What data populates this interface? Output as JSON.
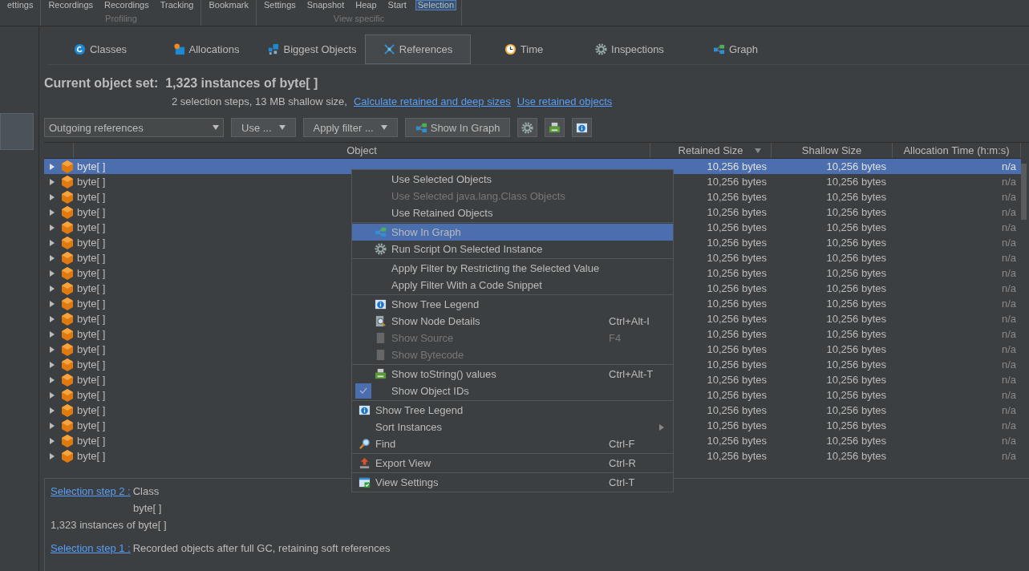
{
  "ribbon": {
    "groups": [
      {
        "buttons": [
          {
            "label": "ettings",
            "selected": false
          }
        ]
      },
      {
        "label": "Profiling",
        "buttons": [
          {
            "label": "Recordings",
            "selected": false
          },
          {
            "label": "Recordings",
            "selected": false
          },
          {
            "label": "Tracking",
            "selected": false
          }
        ]
      },
      {
        "buttons": [
          {
            "label": "Bookmark",
            "selected": false
          }
        ]
      },
      {
        "label": "View specific",
        "buttons": [
          {
            "label": "Settings",
            "selected": false
          },
          {
            "label": "Snapshot",
            "selected": false
          },
          {
            "label": "Heap",
            "selected": false
          },
          {
            "label": "Start",
            "selected": false
          },
          {
            "label": "Selection",
            "selected": true
          }
        ]
      }
    ]
  },
  "tabs": [
    {
      "label": "Classes",
      "kind": "class",
      "selected": false
    },
    {
      "label": "Allocations",
      "kind": "alloc",
      "selected": false
    },
    {
      "label": "Biggest Objects",
      "kind": "biggest",
      "selected": false
    },
    {
      "label": "References",
      "kind": "refs",
      "selected": true
    },
    {
      "label": "Time",
      "kind": "clock",
      "selected": false
    },
    {
      "label": "Inspections",
      "kind": "gear",
      "selected": false
    },
    {
      "label": "Graph",
      "kind": "graph",
      "selected": false
    }
  ],
  "header": {
    "label": "Current object set:",
    "value": "1,323 instances of byte[ ]",
    "summary": "2 selection steps, 13 MB shallow size,",
    "links": [
      "Calculate retained and deep sizes",
      "Use retained objects"
    ]
  },
  "toolbar": {
    "dropdown": "Outgoing references",
    "buttons": [
      "Use ...",
      "Apply filter ..."
    ],
    "graph_button": "Show In Graph"
  },
  "table": {
    "columns": [
      {
        "label": "Object",
        "sorted": false
      },
      {
        "label": "Retained Size",
        "sorted": true
      },
      {
        "label": "Shallow Size",
        "sorted": false
      },
      {
        "label": "Allocation Time (h:m:s)",
        "sorted": false
      }
    ],
    "rows": [
      {
        "object": "byte[ ]",
        "retained": "10,256 bytes",
        "shallow": "10,256 bytes",
        "time": "n/a",
        "selected": true
      },
      {
        "object": "byte[ ]",
        "retained": "10,256 bytes",
        "shallow": "10,256 bytes",
        "time": "n/a",
        "selected": false
      },
      {
        "object": "byte[ ]",
        "retained": "10,256 bytes",
        "shallow": "10,256 bytes",
        "time": "n/a",
        "selected": false
      },
      {
        "object": "byte[ ]",
        "retained": "10,256 bytes",
        "shallow": "10,256 bytes",
        "time": "n/a",
        "selected": false
      },
      {
        "object": "byte[ ]",
        "retained": "10,256 bytes",
        "shallow": "10,256 bytes",
        "time": "n/a",
        "selected": false
      },
      {
        "object": "byte[ ]",
        "retained": "10,256 bytes",
        "shallow": "10,256 bytes",
        "time": "n/a",
        "selected": false
      },
      {
        "object": "byte[ ]",
        "retained": "10,256 bytes",
        "shallow": "10,256 bytes",
        "time": "n/a",
        "selected": false
      },
      {
        "object": "byte[ ]",
        "retained": "10,256 bytes",
        "shallow": "10,256 bytes",
        "time": "n/a",
        "selected": false
      },
      {
        "object": "byte[ ]",
        "retained": "10,256 bytes",
        "shallow": "10,256 bytes",
        "time": "n/a",
        "selected": false
      },
      {
        "object": "byte[ ]",
        "retained": "10,256 bytes",
        "shallow": "10,256 bytes",
        "time": "n/a",
        "selected": false
      },
      {
        "object": "byte[ ]",
        "retained": "10,256 bytes",
        "shallow": "10,256 bytes",
        "time": "n/a",
        "selected": false
      },
      {
        "object": "byte[ ]",
        "retained": "10,256 bytes",
        "shallow": "10,256 bytes",
        "time": "n/a",
        "selected": false
      },
      {
        "object": "byte[ ]",
        "retained": "10,256 bytes",
        "shallow": "10,256 bytes",
        "time": "n/a",
        "selected": false
      },
      {
        "object": "byte[ ]",
        "retained": "10,256 bytes",
        "shallow": "10,256 bytes",
        "time": "n/a",
        "selected": false
      },
      {
        "object": "byte[ ]",
        "retained": "10,256 bytes",
        "shallow": "10,256 bytes",
        "time": "n/a",
        "selected": false
      },
      {
        "object": "byte[ ]",
        "retained": "10,256 bytes",
        "shallow": "10,256 bytes",
        "time": "n/a",
        "selected": false
      },
      {
        "object": "byte[ ]",
        "retained": "10,256 bytes",
        "shallow": "10,256 bytes",
        "time": "n/a",
        "selected": false
      },
      {
        "object": "byte[ ]",
        "retained": "10,256 bytes",
        "shallow": "10,256 bytes",
        "time": "n/a",
        "selected": false
      },
      {
        "object": "byte[ ]",
        "retained": "10,256 bytes",
        "shallow": "10,256 bytes",
        "time": "n/a",
        "selected": false
      },
      {
        "object": "byte[ ]",
        "retained": "10,256 bytes",
        "shallow": "10,256 bytes",
        "time": "n/a",
        "selected": false
      }
    ]
  },
  "context_menu": {
    "sections": [
      {
        "inset": true,
        "items": [
          {
            "kind": "plain",
            "label": "Use Selected Objects",
            "disabled": false,
            "selected": false
          },
          {
            "kind": "plain",
            "label": "Use Selected java.lang.Class Objects",
            "disabled": true,
            "selected": false
          },
          {
            "kind": "plain",
            "label": "Use Retained Objects",
            "disabled": false,
            "selected": false
          }
        ]
      },
      {
        "inset": true,
        "items": [
          {
            "kind": "graph",
            "label": "Show In Graph",
            "disabled": false,
            "selected": true
          },
          {
            "kind": "gear",
            "label": "Run Script On Selected Instance",
            "disabled": false,
            "selected": false
          }
        ]
      },
      {
        "inset": true,
        "items": [
          {
            "kind": "plain",
            "label": "Apply Filter by Restricting the Selected Value",
            "disabled": false,
            "selected": false
          },
          {
            "kind": "plain",
            "label": "Apply Filter With a Code Snippet",
            "disabled": false,
            "selected": false
          }
        ]
      },
      {
        "inset": true,
        "items": [
          {
            "kind": "info",
            "label": "Show Tree Legend",
            "disabled": false,
            "selected": false
          },
          {
            "kind": "magnifier",
            "label": "Show Node Details",
            "shortcut": "Ctrl+Alt-I",
            "disabled": false,
            "selected": false
          },
          {
            "kind": "page",
            "label": "Show Source",
            "shortcut": "F4",
            "disabled": true,
            "selected": false
          },
          {
            "kind": "page",
            "label": "Show Bytecode",
            "disabled": true,
            "selected": false
          }
        ]
      },
      {
        "inset": true,
        "items": [
          {
            "kind": "printer",
            "label": "Show toString() values",
            "shortcut": "Ctrl+Alt-T",
            "disabled": false,
            "selected": false
          },
          {
            "kind": "check",
            "label": "Show Object IDs",
            "checked": true,
            "disabled": false,
            "selected": false
          }
        ]
      },
      {
        "inset": false,
        "items": [
          {
            "kind": "info",
            "label": "Show Tree Legend",
            "disabled": false,
            "selected": false
          },
          {
            "kind": "submenu",
            "label": "Sort Instances",
            "disabled": false,
            "selected": false
          },
          {
            "kind": "find",
            "label": "Find",
            "shortcut": "Ctrl-F",
            "disabled": false,
            "selected": false
          }
        ]
      },
      {
        "inset": false,
        "items": [
          {
            "kind": "export",
            "label": "Export View",
            "shortcut": "Ctrl-R",
            "disabled": false,
            "selected": false
          }
        ]
      },
      {
        "inset": false,
        "items": [
          {
            "kind": "settings",
            "label": "View Settings",
            "shortcut": "Ctrl-T",
            "disabled": false,
            "selected": false
          }
        ]
      }
    ]
  },
  "steps": [
    {
      "link": "Selection step 2 :",
      "text": "Class",
      "detail": "byte[ ]",
      "result": "1,323 instances of byte[ ]"
    },
    {
      "link": "Selection step 1 :",
      "text": "Recorded objects after full GC, retaining soft references"
    }
  ]
}
